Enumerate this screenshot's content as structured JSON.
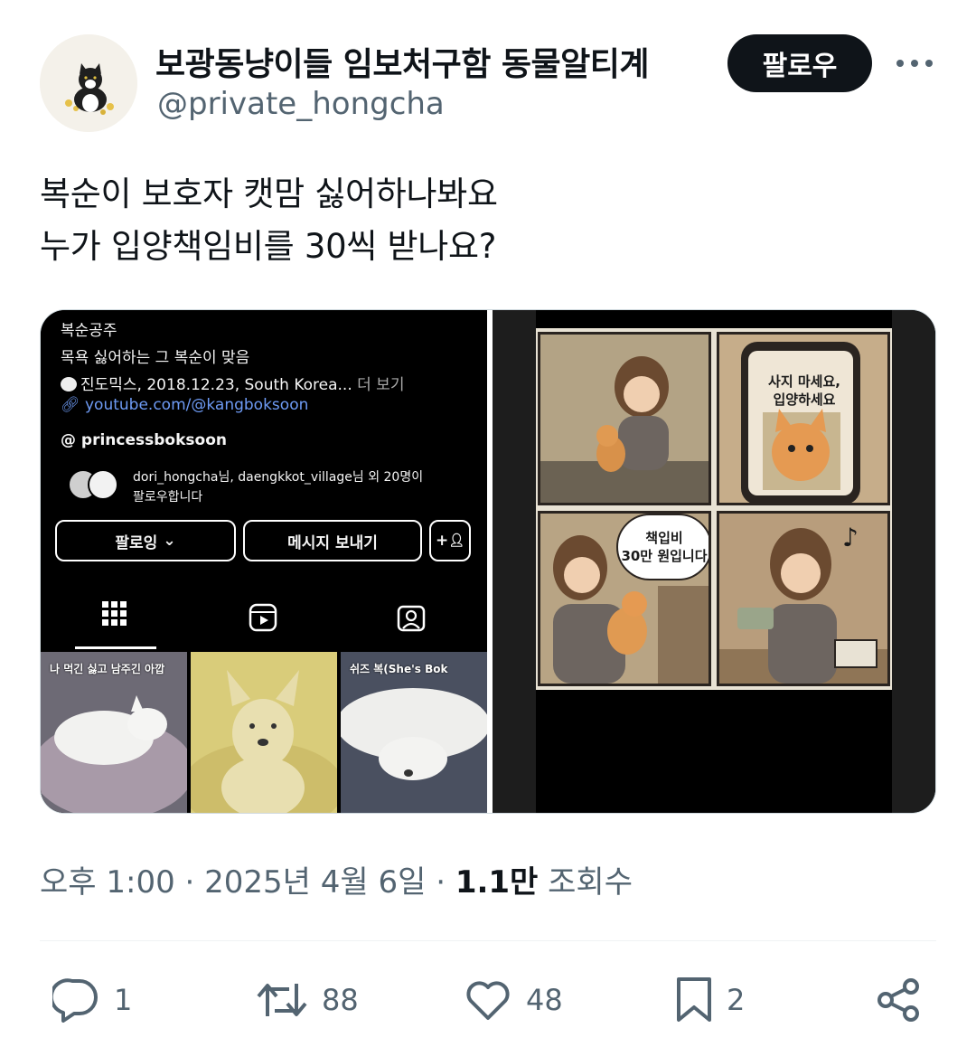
{
  "tweet": {
    "display_name": "보광동냥이들 임보처구함 동물알티계",
    "handle": "@private_hongcha",
    "follow_label": "팔로우",
    "text_lines": [
      "복순이 보호자 캣맘 싫어하나봐요",
      "누가 입양책임비를 30씩 받나요?"
    ],
    "timestamp": "오후 1:00 · 2025년 4월 6일 ·",
    "views_count": "1.1만",
    "views_label": "조회수"
  },
  "instagram_screenshot": {
    "name": "복순공주",
    "bio": "목욕 싫어하는 그 복순이 맞음",
    "info": "진도믹스, 2018.12.23, South Korea...",
    "more": "더 보기",
    "link": "youtube.com/@kangboksoon",
    "threads": "princessboksoon",
    "followed_by": "dori_hongcha님, daengkkot_village님 외 20명이",
    "followed_by_2": "팔로우합니다",
    "following_button": "팔로잉",
    "message_button": "메시지 보내기",
    "add_button": "+",
    "reels": [
      {
        "label": "나 먹긴 싫고 남주긴 아깝"
      },
      {
        "label": ""
      },
      {
        "label": "쉬즈 복(She's Bok"
      }
    ]
  },
  "comic": {
    "bubble_1_line1": "사지 마세요,",
    "bubble_1_line2": "입양하세요",
    "bubble_2_line1": "책입비",
    "bubble_2_line2": "30만 원입니다",
    "music_note": "♪"
  },
  "actions": {
    "reply_count": "1",
    "retweet_count": "88",
    "like_count": "48",
    "bookmark_count": "2"
  },
  "colors": {
    "text_primary": "#0f1419",
    "text_secondary": "#536471",
    "follow_bg": "#0f1419",
    "ig_link": "#6e9bf5"
  }
}
